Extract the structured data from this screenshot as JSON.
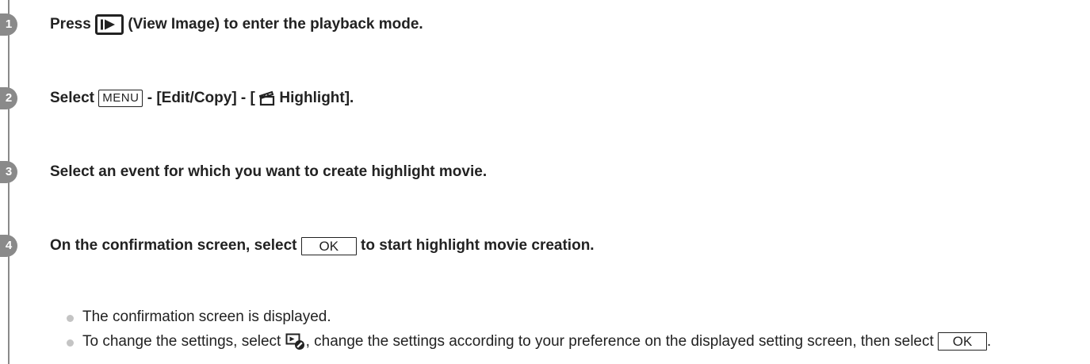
{
  "steps": [
    {
      "number": "1",
      "parts": [
        "Press ",
        " (View Image) to enter the playback mode."
      ],
      "icon": "view-image-icon"
    },
    {
      "number": "2",
      "parts": [
        "Select ",
        "MENU",
        " - [Edit/Copy] - [ ",
        "Highlight]."
      ],
      "icon": "highlight-clapper-icon"
    },
    {
      "number": "3",
      "text": "Select an event for which you want to create highlight movie."
    },
    {
      "number": "4",
      "parts": [
        "On the confirmation screen, select ",
        "OK",
        " to start highlight movie creation."
      ]
    }
  ],
  "notes": [
    {
      "text": "The confirmation screen is displayed."
    },
    {
      "parts": [
        "To change the settings, select ",
        ", change the settings according to your preference on the displayed setting screen, then select ",
        "OK",
        "."
      ],
      "icon": "playback-settings-icon"
    }
  ]
}
